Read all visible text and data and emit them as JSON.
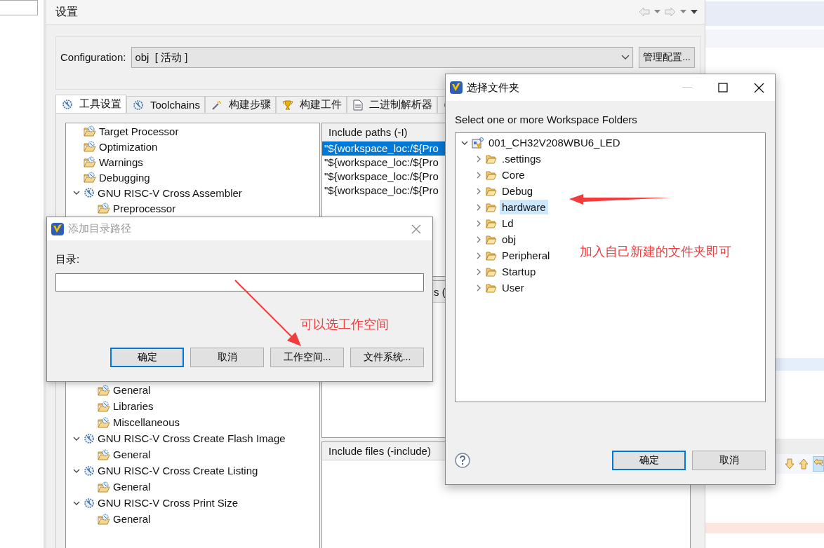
{
  "settings": {
    "title": "设置",
    "configuration": {
      "label": "Configuration:",
      "value": "obj  [ 活动 ]",
      "manage_button": "管理配置..."
    },
    "tabs": [
      {
        "kind": "tool",
        "label": "工具设置",
        "selected": true
      },
      {
        "kind": "toolchain",
        "label": "Toolchains",
        "selected": false
      },
      {
        "kind": "steps",
        "label": "构建步骤",
        "selected": false
      },
      {
        "kind": "artifact",
        "label": "构建工件",
        "selected": false
      },
      {
        "kind": "binary",
        "label": "二进制解析器",
        "selected": false
      },
      {
        "kind": "error",
        "selected": false
      }
    ],
    "tool_tree": {
      "upper": [
        {
          "label": "Target Processor"
        },
        {
          "label": "Optimization"
        },
        {
          "label": "Warnings"
        },
        {
          "label": "Debugging"
        },
        {
          "label": "GNU RISC-V Cross Assembler",
          "expanded": true,
          "children": [
            {
              "label": "Preprocessor"
            }
          ]
        }
      ],
      "lower": [
        {
          "kind": "continued",
          "children": [
            {
              "label": "General"
            },
            {
              "label": "Libraries"
            },
            {
              "label": "Miscellaneous"
            }
          ]
        },
        {
          "label": "GNU RISC-V Cross Create Flash Image",
          "expanded": true,
          "children": [
            {
              "label": "General"
            }
          ]
        },
        {
          "label": "GNU RISC-V Cross Create Listing",
          "expanded": true,
          "children": [
            {
              "label": "General"
            }
          ]
        },
        {
          "label": "GNU RISC-V Cross Print Size",
          "expanded": true,
          "children": [
            {
              "label": "General"
            }
          ]
        }
      ]
    },
    "option_panes": [
      {
        "header": "Include paths (-I)",
        "items": [
          {
            "text": "\"${workspace_loc:/${Pro",
            "selected": true
          },
          {
            "text": "\"${workspace_loc:/${Pro",
            "selected": false
          },
          {
            "text": "\"${workspace_loc:/${Pro",
            "selected": false
          },
          {
            "text": "\"${workspace_loc:/${Pro",
            "selected": false
          }
        ]
      },
      {
        "header": "s ("
      },
      {
        "header": "Include files (-include)"
      }
    ]
  },
  "add_directory_dialog": {
    "title": "添加目录路径",
    "active": false,
    "label": "目录:",
    "buttons": [
      {
        "label": "确定",
        "default": true
      },
      {
        "label": "取消",
        "default": false
      },
      {
        "label": "工作空间...",
        "default": false
      },
      {
        "label": "文件系统...",
        "default": false
      }
    ],
    "annotation": "可以选工作空间"
  },
  "folder_dialog": {
    "title": "选择文件夹",
    "active": true,
    "message": "Select one or more Workspace Folders",
    "tree": [
      {
        "kind": "project",
        "label": "001_CH32V208WBU6_LED",
        "expanded": true,
        "selected": false,
        "children": [
          {
            "kind": "folder",
            "label": ".settings",
            "expanded": false,
            "selected": false
          },
          {
            "kind": "folder",
            "label": "Core",
            "expanded": false,
            "selected": false
          },
          {
            "kind": "folder",
            "label": "Debug",
            "expanded": false,
            "selected": false
          },
          {
            "kind": "folder",
            "label": "hardware",
            "expanded": false,
            "selected": true
          },
          {
            "kind": "folder",
            "label": "Ld",
            "expanded": false,
            "selected": false
          },
          {
            "kind": "folder",
            "label": "obj",
            "expanded": false,
            "selected": false
          },
          {
            "kind": "folder",
            "label": "Peripheral",
            "expanded": false,
            "selected": false
          },
          {
            "kind": "folder",
            "label": "Startup",
            "expanded": false,
            "selected": false
          },
          {
            "kind": "folder",
            "label": "User",
            "expanded": false,
            "selected": false
          }
        ]
      }
    ],
    "buttons": [
      {
        "label": "确定",
        "default": true
      },
      {
        "label": "取消",
        "default": false
      }
    ],
    "annotation": "加入自己新建的文件夹即可"
  }
}
